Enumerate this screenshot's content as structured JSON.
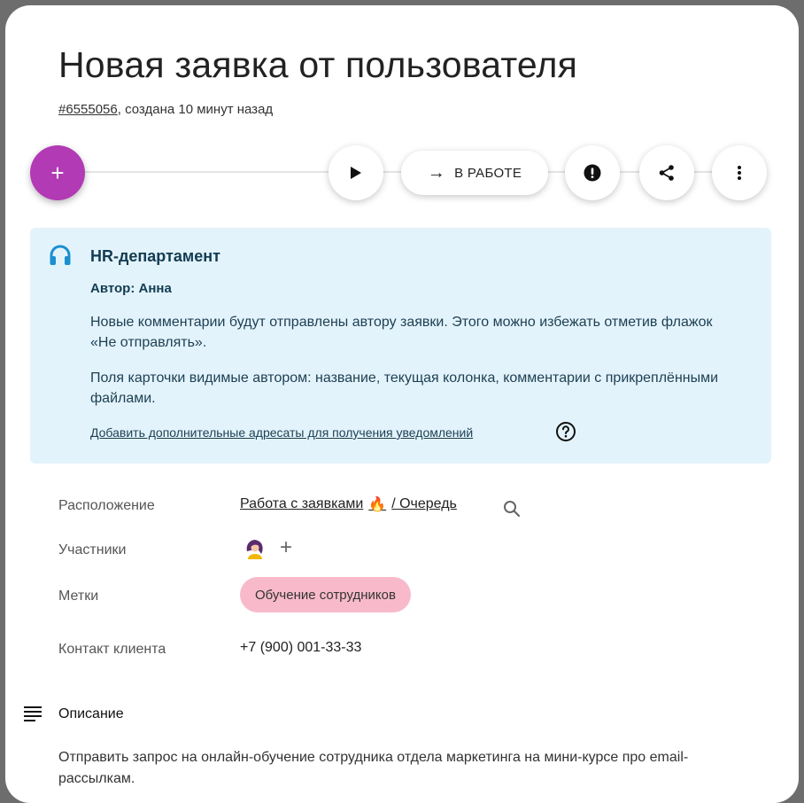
{
  "ticket": {
    "title": "Новая заявка от пользователя",
    "id_link": "#6555056",
    "created_text": ", создана 10 минут назад"
  },
  "toolbar": {
    "add_label": "+",
    "status_label": "В РАБОТЕ",
    "status_arrow": "→",
    "add_color": "#b23ab5"
  },
  "info": {
    "department": "HR-департамент",
    "author": "Автор: Анна",
    "paragraph1": "Новые комментарии будут отправлены автору заявки. Этого можно избежать отметив флажок «Не отправлять».",
    "paragraph2": "Поля карточки видимые автором: название, текущая колонка, комментарии с прикреплёнными файлами.",
    "link": "Добавить дополнительные адресаты для получения уведомлений",
    "background": "#e3f3fb"
  },
  "fields": {
    "location_label": "Расположение",
    "location_board": "Работа с заявками",
    "location_flame": "🔥",
    "location_column": "/ Очередь",
    "members_label": "Участники",
    "members_add": "+",
    "tags_label": "Метки",
    "tag": "Обучение сотрудников",
    "tag_color": "#f8bacb",
    "contact_label": "Контакт клиента",
    "contact_value": "+7 (900) 001-33-33"
  },
  "description": {
    "title": "Описание",
    "text": "Отправить запрос на онлайн-обучение сотрудника отдела маркетинга на мини-курсе про email-рассылкам."
  }
}
